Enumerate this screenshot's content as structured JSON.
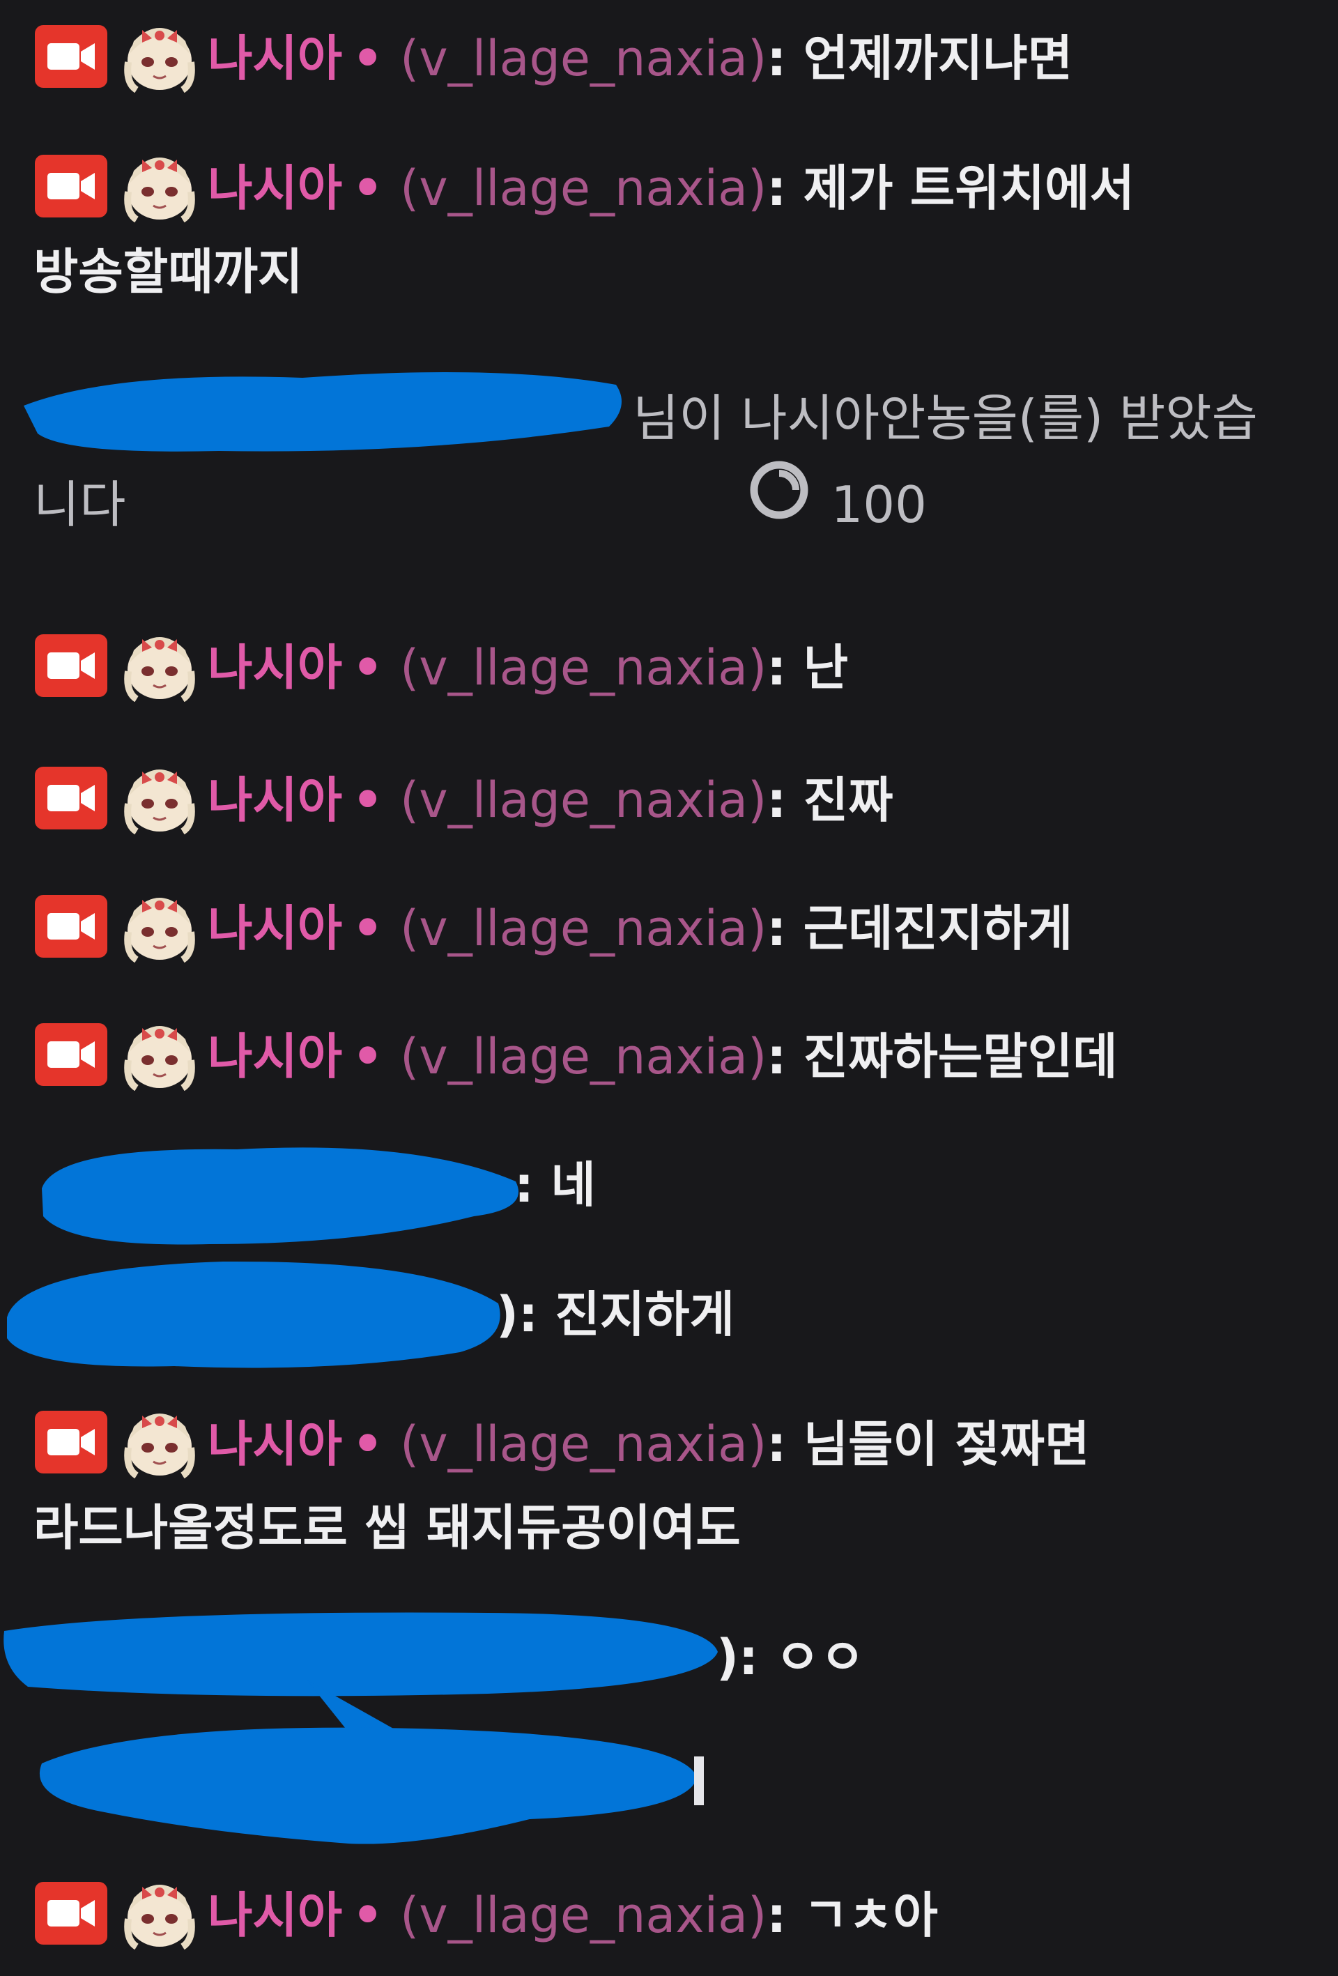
{
  "streamer": {
    "display_name": "나시아",
    "separator": "•",
    "login": "(v_llage_naxia)",
    "colon": ":",
    "name_color": "#e05aa8",
    "login_color": "#a8568a",
    "badge_icon": "broadcaster-camera-icon",
    "avatar_icon": "anime-girl-avatar-icon"
  },
  "messages": [
    {
      "text": "언제까지냐면"
    },
    {
      "text": "제가 트위치에서 방송할때까지"
    },
    {
      "text": "난"
    },
    {
      "text": "진짜"
    },
    {
      "text": "근데진지하게"
    },
    {
      "text": "진짜하는말인데"
    },
    {
      "text": "님들이 젖짜면 라드나올정도로 씹 돼지듀공이여도"
    },
    {
      "text": "ㄱㅊ아"
    }
  ],
  "redemption": {
    "text": "님이 나시아안농을(를) 받았습니다",
    "points_icon": "channel-points-icon",
    "points": "100"
  },
  "viewer_messages": [
    {
      "colon": ":",
      "text": "네"
    },
    {
      "colon": "):",
      "text": "진지하게"
    },
    {
      "colon": "):",
      "text": "ㅇㅇ"
    }
  ],
  "redaction_color": "#0275d8"
}
